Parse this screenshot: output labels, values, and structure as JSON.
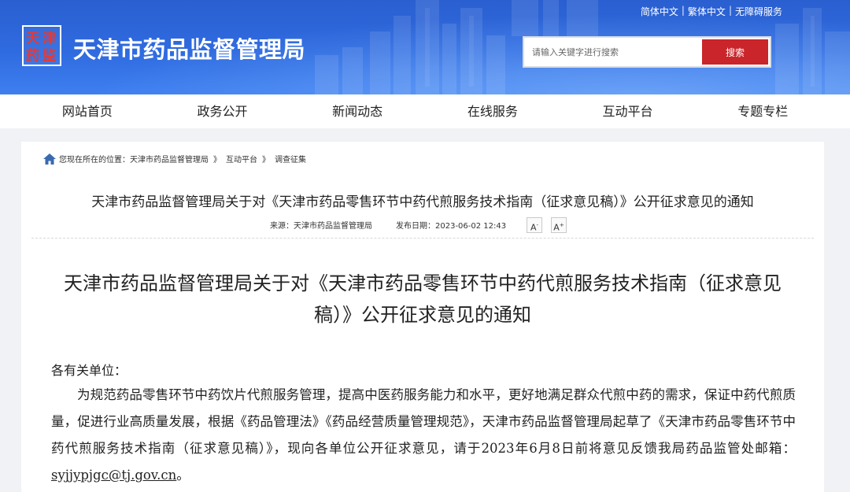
{
  "header": {
    "site_title": "天津市药品监督管理局",
    "seal_text": [
      "天",
      "津",
      "药",
      "监"
    ],
    "top_links": [
      "简体中文",
      "繁体中文",
      "无障碍服务"
    ],
    "search": {
      "placeholder": "请输入关键字进行搜索",
      "button_label": "搜索"
    }
  },
  "nav": [
    "网站首页",
    "政务公开",
    "新闻动态",
    "在线服务",
    "互动平台",
    "专题专栏"
  ],
  "breadcrumb": {
    "prefix": "您现在所在的位置：",
    "items": [
      "天津市药品监督管理局",
      "互动平台",
      "调查征集"
    ],
    "separator": "》"
  },
  "article": {
    "header_title": "天津市药品监督管理局关于对《天津市药品零售环节中药代煎服务技术指南（征求意见稿）》公开征求意见的通知",
    "source": "来源：天津市药品监督管理局",
    "date": "发布日期：2023-06-02 12:43",
    "font_smaller": "A",
    "font_larger": "A",
    "title_line1": "天津市药品监督管理局关于对《天津市药品零售环节中药代煎服务技术指南（征求意见",
    "title_line2": "稿）》公开征求意见的通知",
    "salutation": "各有关单位：",
    "paragraph": "为规范药品零售环节中药饮片代煎服务管理，提高中医药服务能力和水平，更好地满足群众代煎中药的需求，保证中药代煎质量，促进行业高质量发展，根据《药品管理法》《药品经营质量管理规范》，天津市药品监督管理局起草了《天津市药品零售环节中药代煎服务技术指南（征求意见稿）》，现向各单位公开征求意见，请于2023年6月8日前将意见反馈我局药品监管处邮箱：",
    "email": "syjjypjgc@tj.gov.cn",
    "end_mark": "。"
  },
  "colors": {
    "banner": "#2f6be0",
    "search_button": "#c9252a",
    "background": "#f0f2f5"
  }
}
